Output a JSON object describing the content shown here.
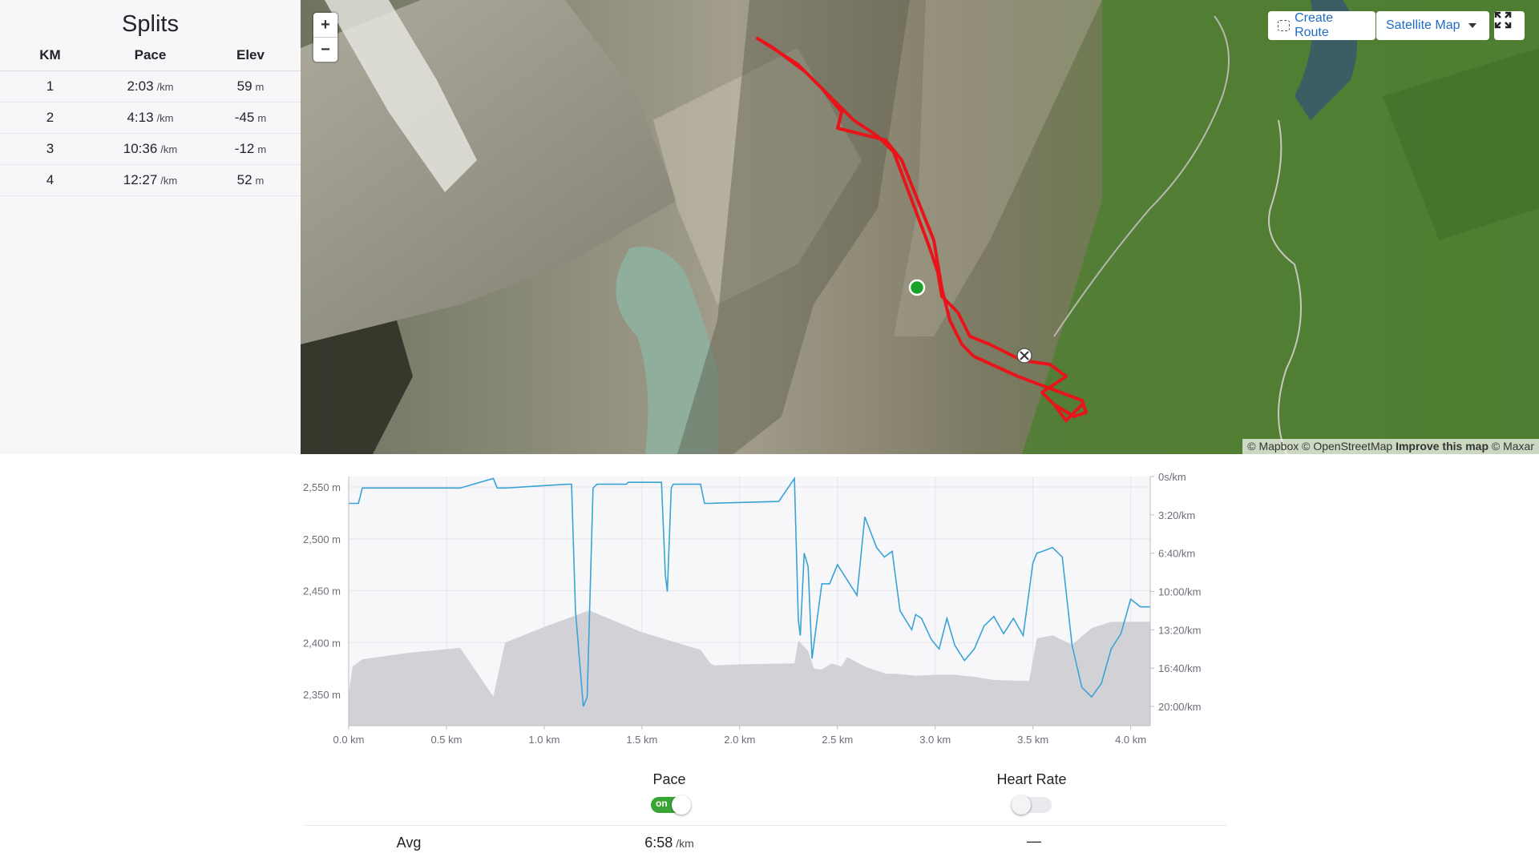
{
  "splits": {
    "title": "Splits",
    "headers": [
      "KM",
      "Pace",
      "Elev"
    ],
    "rows": [
      {
        "km": "1",
        "pace": "2:03",
        "pace_unit": "/km",
        "elev": "59",
        "elev_unit": "m"
      },
      {
        "km": "2",
        "pace": "4:13",
        "pace_unit": "/km",
        "elev": "-45",
        "elev_unit": "m"
      },
      {
        "km": "3",
        "pace": "10:36",
        "pace_unit": "/km",
        "elev": "-12",
        "elev_unit": "m"
      },
      {
        "km": "4",
        "pace": "12:27",
        "pace_unit": "/km",
        "elev": "52",
        "elev_unit": "m"
      }
    ]
  },
  "map": {
    "zoom_in": "+",
    "zoom_out": "−",
    "create_route": "Create Route",
    "map_type": "Satellite Map",
    "attribution": {
      "mapbox": "© Mapbox",
      "osm": "© OpenStreetMap",
      "improve": "Improve this map",
      "maxar": "© Maxar"
    },
    "colors": {
      "route": "#e8141a",
      "start_marker": "#1aa32a",
      "end_marker": "#ffffff"
    }
  },
  "chart_data": {
    "type": "area",
    "x_unit": "km",
    "xlim": [
      0,
      4.1
    ],
    "xticks": [
      "0.0 km",
      "0.5 km",
      "1.0 km",
      "1.5 km",
      "2.0 km",
      "2.5 km",
      "3.0 km",
      "3.5 km",
      "4.0 km"
    ],
    "xtick_values": [
      0,
      0.5,
      1.0,
      1.5,
      2.0,
      2.5,
      3.0,
      3.5,
      4.0
    ],
    "y_left_ticks": [
      "2,550 m",
      "2,500 m",
      "2,450 m",
      "2,400 m",
      "2,350 m"
    ],
    "y_left_values": [
      2550,
      2500,
      2450,
      2400,
      2350
    ],
    "y_left_range": [
      2320,
      2560
    ],
    "y_right_ticks": [
      "0s/km",
      "3:20/km",
      "6:40/km",
      "10:00/km",
      "13:20/km",
      "16:40/km",
      "20:00/km"
    ],
    "y_right_values": [
      0,
      200,
      400,
      600,
      800,
      1000,
      1200
    ],
    "y_right_range": [
      0,
      1300
    ],
    "series": [
      {
        "name": "Elevation",
        "color": "#d2d2d6",
        "x": [
          0,
          0.02,
          0.07,
          0.3,
          0.57,
          0.74,
          0.8,
          1.0,
          1.23,
          1.5,
          1.8,
          1.85,
          1.87,
          2.0,
          2.28,
          2.3,
          2.35,
          2.38,
          2.42,
          2.47,
          2.52,
          2.55,
          2.65,
          2.75,
          2.8,
          2.9,
          3.0,
          3.1,
          3.2,
          3.3,
          3.47,
          3.48,
          3.52,
          3.6,
          3.7,
          3.8,
          3.9,
          4.0,
          4.1
        ],
        "values": [
          2350,
          2377,
          2384,
          2390,
          2395,
          2348,
          2400,
          2415,
          2431,
          2410,
          2393,
          2380,
          2378,
          2379,
          2380,
          2402,
          2392,
          2375,
          2374,
          2380,
          2377,
          2386,
          2376,
          2370,
          2370,
          2368,
          2369,
          2369,
          2367,
          2364,
          2363,
          2363,
          2404,
          2407,
          2398,
          2414,
          2420,
          2420,
          2420
        ]
      },
      {
        "name": "Pace",
        "color": "#3aa3d6",
        "x": [
          0,
          0.05,
          0.07,
          0.3,
          0.57,
          0.74,
          0.76,
          0.79,
          0.8,
          1.12,
          1.14,
          1.16,
          1.2,
          1.22,
          1.25,
          1.27,
          1.42,
          1.43,
          1.45,
          1.6,
          1.62,
          1.63,
          1.65,
          1.66,
          1.8,
          1.82,
          1.84,
          2.2,
          2.28,
          2.3,
          2.31,
          2.33,
          2.35,
          2.37,
          2.42,
          2.46,
          2.5,
          2.55,
          2.6,
          2.64,
          2.7,
          2.74,
          2.78,
          2.82,
          2.88,
          2.9,
          2.93,
          2.98,
          3.02,
          3.06,
          3.1,
          3.15,
          3.2,
          3.25,
          3.3,
          3.35,
          3.4,
          3.45,
          3.5,
          3.52,
          3.55,
          3.6,
          3.65,
          3.7,
          3.75,
          3.8,
          3.85,
          3.9,
          3.95,
          4.0,
          4.05,
          4.1
        ],
        "values": [
          140,
          140,
          60,
          60,
          60,
          10,
          60,
          60,
          60,
          40,
          40,
          700,
          1200,
          1150,
          60,
          40,
          40,
          30,
          30,
          30,
          520,
          600,
          60,
          40,
          40,
          140,
          140,
          130,
          10,
          750,
          830,
          400,
          470,
          950,
          560,
          560,
          460,
          540,
          620,
          210,
          370,
          420,
          390,
          700,
          800,
          720,
          740,
          850,
          900,
          740,
          880,
          960,
          900,
          780,
          730,
          820,
          740,
          830,
          450,
          400,
          390,
          370,
          420,
          880,
          1100,
          1150,
          1080,
          900,
          820,
          640,
          680,
          680
        ]
      }
    ]
  },
  "bottom": {
    "pace_label": "Pace",
    "pace_toggle": "on",
    "hr_label": "Heart Rate",
    "avg_label": "Avg",
    "avg_pace": "6:58",
    "avg_pace_unit": "/km",
    "avg_hr": "—"
  }
}
